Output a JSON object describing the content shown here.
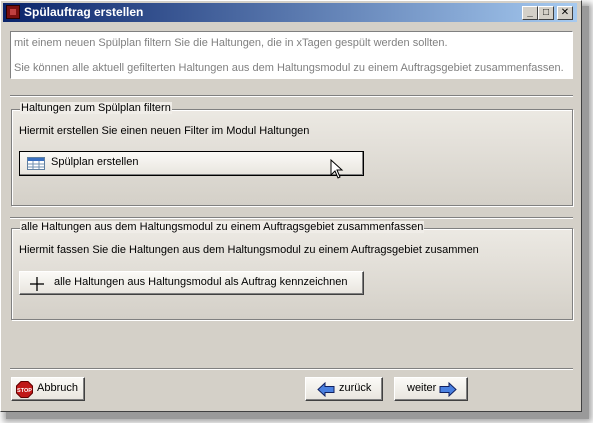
{
  "window": {
    "title": "Spülauftrag erstellen",
    "minimize": "_",
    "maximize": "□",
    "close": "✕"
  },
  "info": {
    "line1": "mit einem neuen Spülplan filtern Sie die Haltungen, die in xTagen gespült werden sollten.",
    "line2": "Sie können alle aktuell gefilterten Haltungen aus dem Haltungsmodul zu einem Auftragsgebiet zusammenfassen."
  },
  "group1": {
    "legend": "Haltungen zum Spülplan filtern",
    "description": "Hiermit erstellen Sie einen neuen Filter im Modul Haltungen",
    "button_label": "Spülplan erstellen",
    "button_icon": "grid-table-icon"
  },
  "group2": {
    "legend": "alle Haltungen aus dem Haltungsmodul zu einem Auftragsgebiet zusammenfassen",
    "description": "Hiermit fassen Sie die Haltungen aus dem Haltungsmodul zu einem Auftragsgebiet zusammen",
    "button_label": "alle Haltungen aus Haltungsmodul als Auftrag kennzeichnen",
    "button_icon": "plus-icon"
  },
  "footer": {
    "abort_label": "Abbruch",
    "abort_icon": "stop-sign-icon",
    "back_label": "zurück",
    "back_icon": "arrow-left-icon",
    "next_label": "weiter",
    "next_icon": "arrow-right-icon"
  },
  "colors": {
    "title_gradient_start": "#0a246a",
    "title_gradient_end": "#a6caf0",
    "face": "#d4d0c8",
    "stop_red": "#c01818",
    "arrow_blue": "#2050c0"
  }
}
